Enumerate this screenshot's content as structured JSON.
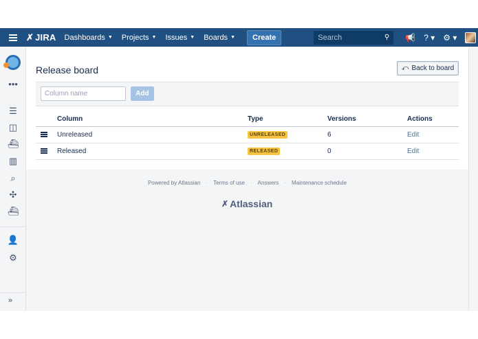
{
  "topbar": {
    "logo_text": "JIRA",
    "nav": [
      {
        "label": "Dashboards"
      },
      {
        "label": "Projects"
      },
      {
        "label": "Issues"
      },
      {
        "label": "Boards"
      }
    ],
    "create_label": "Create",
    "search_placeholder": "Search"
  },
  "page": {
    "title": "Release board",
    "back_label": "Back to board",
    "column_name_placeholder": "Column name",
    "add_label": "Add"
  },
  "table": {
    "headers": {
      "column": "Column",
      "type": "Type",
      "versions": "Versions",
      "actions": "Actions"
    },
    "rows": [
      {
        "name": "Unreleased",
        "type": "UNRELEASED",
        "versions": "6",
        "action": "Edit"
      },
      {
        "name": "Released",
        "type": "RELEASED",
        "versions": "0",
        "action": "Edit"
      }
    ]
  },
  "footer": {
    "links": [
      "Powered by Atlassian",
      "Terms of use",
      "Answers",
      "Maintenance schedule"
    ],
    "logo_text": "Atlassian"
  },
  "colors": {
    "topbar": "#205081",
    "create_button": "#3572b0",
    "lozenge": "#f6c342",
    "link": "#3b73af"
  }
}
